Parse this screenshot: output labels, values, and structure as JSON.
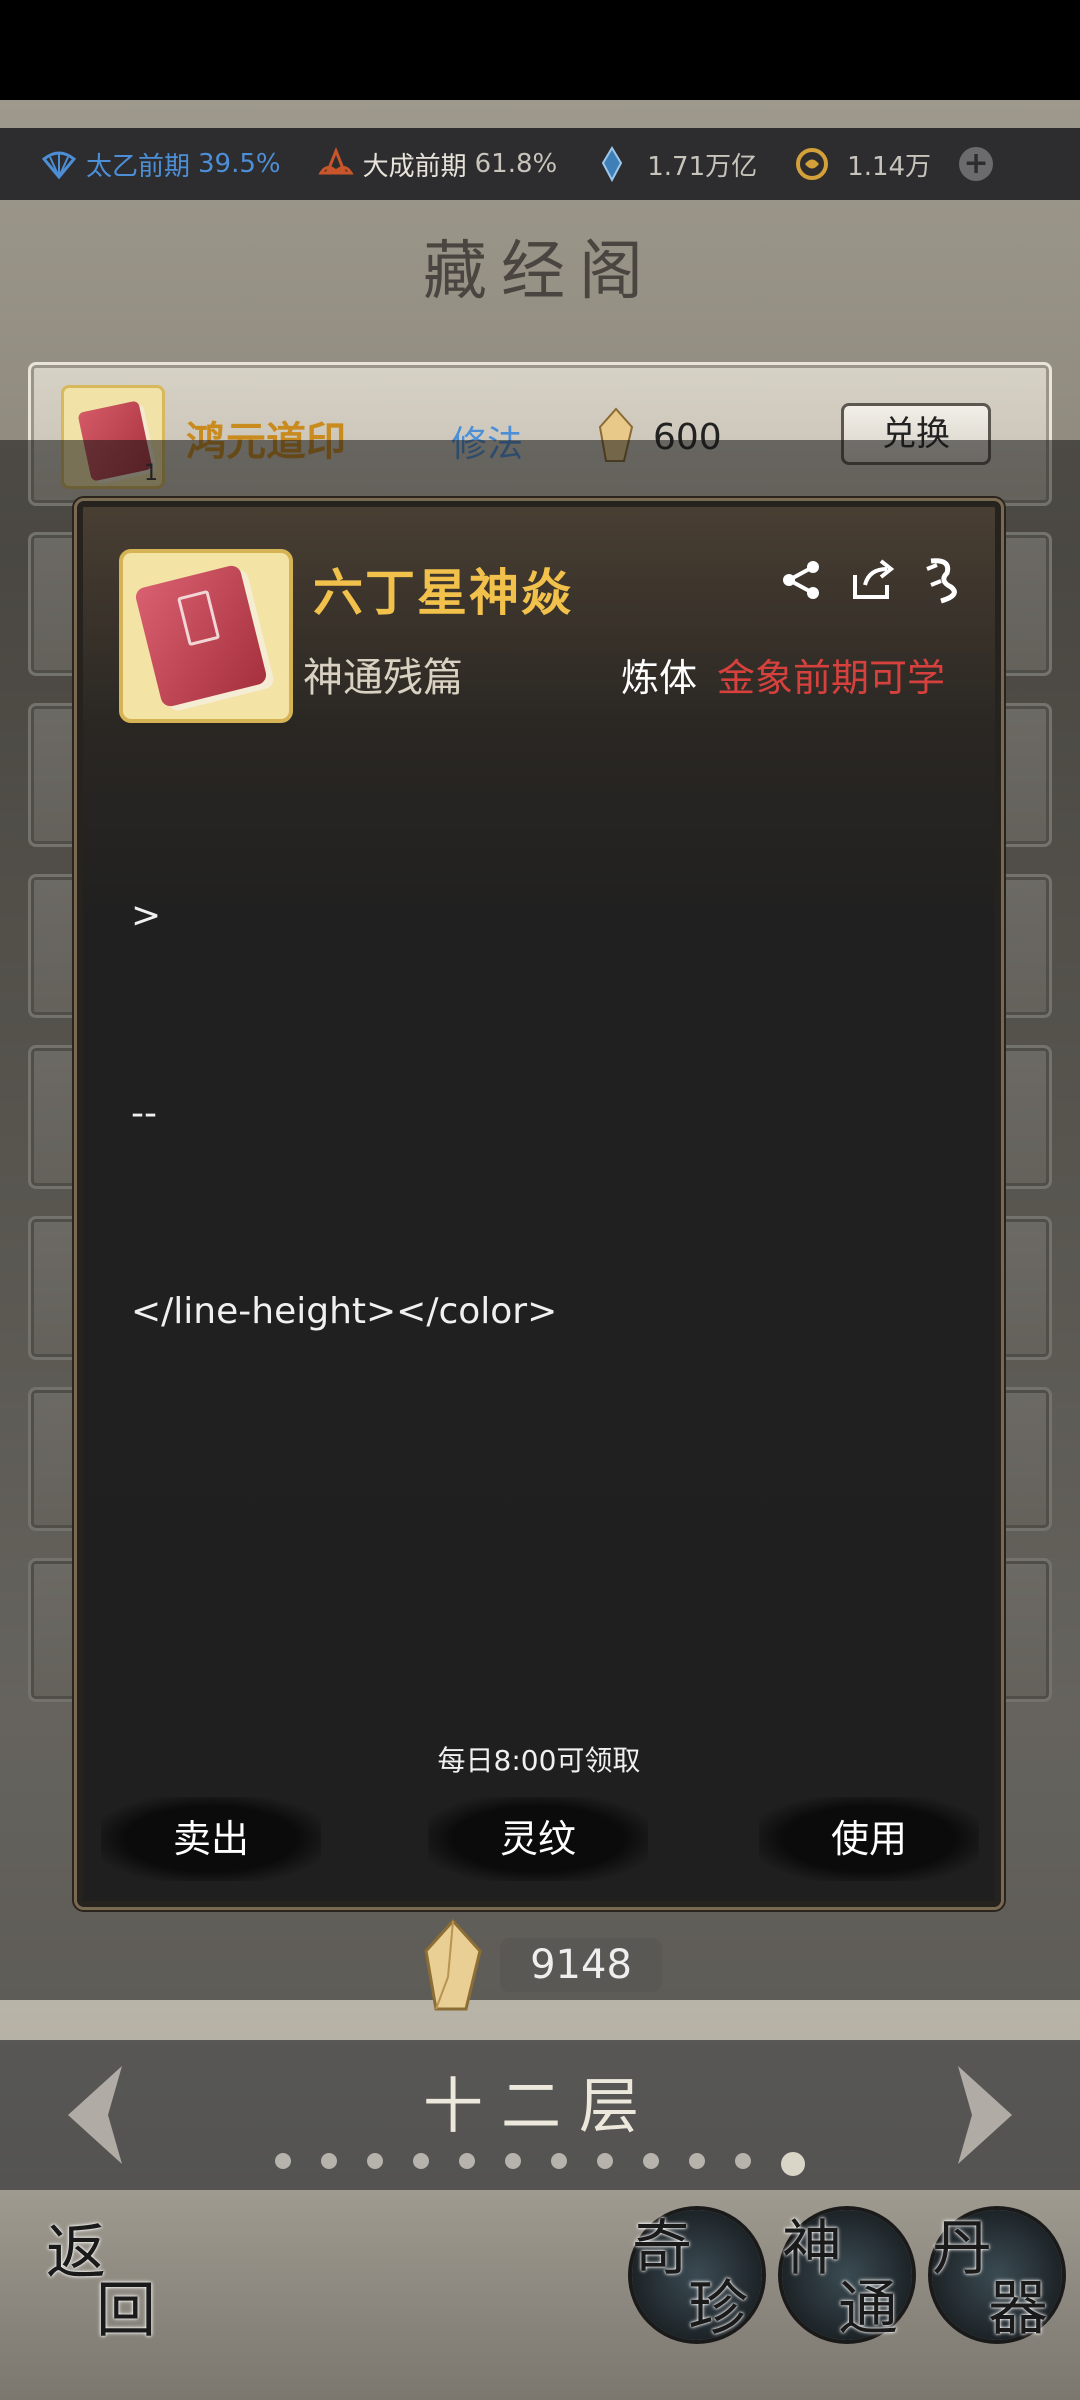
{
  "status_bar": {
    "realm1_label": "太乙前期",
    "realm1_value": "39.5%",
    "realm2_label": "大成前期",
    "realm2_value": "61.8%",
    "spirit_stones": "1.71万亿",
    "coins": "1.14万",
    "plus": "+"
  },
  "page_title": "藏经阁",
  "list": {
    "row1": {
      "count": "1",
      "name": "鸿元道印",
      "tag": "修法",
      "price": "600",
      "button": "兑换"
    }
  },
  "modal": {
    "item_name": "六丁星神焱",
    "item_type": "神通残篇",
    "requirement_label": "炼体",
    "requirement_value": "金象前期可学",
    "description_lines": [
      ">",
      "--",
      "</line-height></color>"
    ],
    "daily_note": "每日8:00可领取",
    "actions": {
      "sell": "卖出",
      "rune": "灵纹",
      "use": "使用"
    }
  },
  "currency": {
    "amount": "9148"
  },
  "floor": {
    "label": "十二层",
    "total_pages": 12,
    "current_page": 12
  },
  "bottom_nav": {
    "back": [
      "返",
      "回"
    ],
    "treasure": [
      "奇",
      "珍"
    ],
    "divine": [
      "神",
      "通"
    ],
    "artifact": [
      "丹",
      "器"
    ]
  },
  "colors": {
    "item_name": "#f2c14c",
    "requirement_value": "#d6413d",
    "realm_blue": "#4d8fd6"
  }
}
